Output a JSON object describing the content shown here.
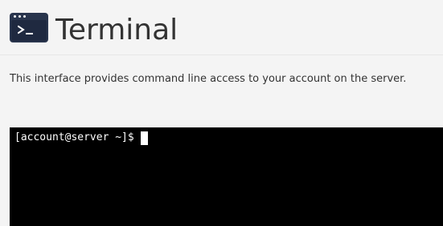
{
  "header": {
    "icon": "terminal-app-icon",
    "title": "Terminal"
  },
  "description": "This interface provides command line access to your account on the server.",
  "terminal": {
    "prompt": "[account@server ~]$",
    "background": "#000000",
    "foreground": "#ffffff"
  },
  "colors": {
    "page_background": "#f4f4f4",
    "icon_background": "#29354d",
    "text": "#333333"
  }
}
